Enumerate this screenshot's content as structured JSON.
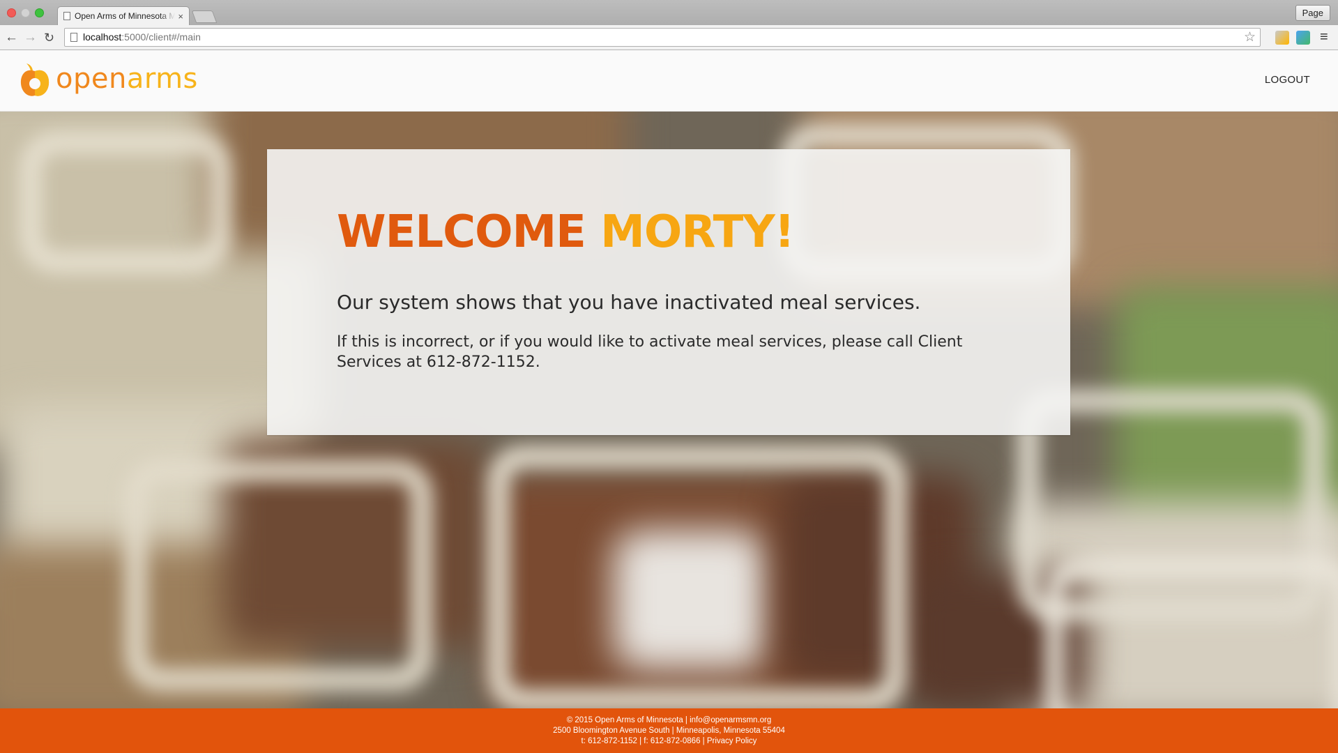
{
  "browser": {
    "tab_title": "Open Arms of Minnesota Meal Services",
    "tab_close": "×",
    "page_button": "Page",
    "url_host": "localhost",
    "url_path": ":5000/client#/main"
  },
  "header": {
    "logo_open": "open",
    "logo_arms": "arms",
    "logout_label": "LOGOUT"
  },
  "card": {
    "welcome_word": "WELCOME",
    "name": "MORTY!",
    "lead": "Our system shows that you have inactivated meal services.",
    "sub": "If this is incorrect, or if you would like to activate meal services, please call Client Services at 612-872-1152."
  },
  "footer": {
    "copyright": "© 2015 Open Arms of Minnesota | ",
    "email": "info@openarmsmn.org",
    "address": "2500 Bloomington Avenue South | Minneapolis, Minnesota 55404",
    "phones": "t: 612-872-1152 | f: 612-872-0866 | ",
    "privacy": "Privacy Policy"
  },
  "colors": {
    "brand_orange": "#e05a0e",
    "brand_yellow": "#f7a612",
    "footer_bg": "#e2540c"
  }
}
